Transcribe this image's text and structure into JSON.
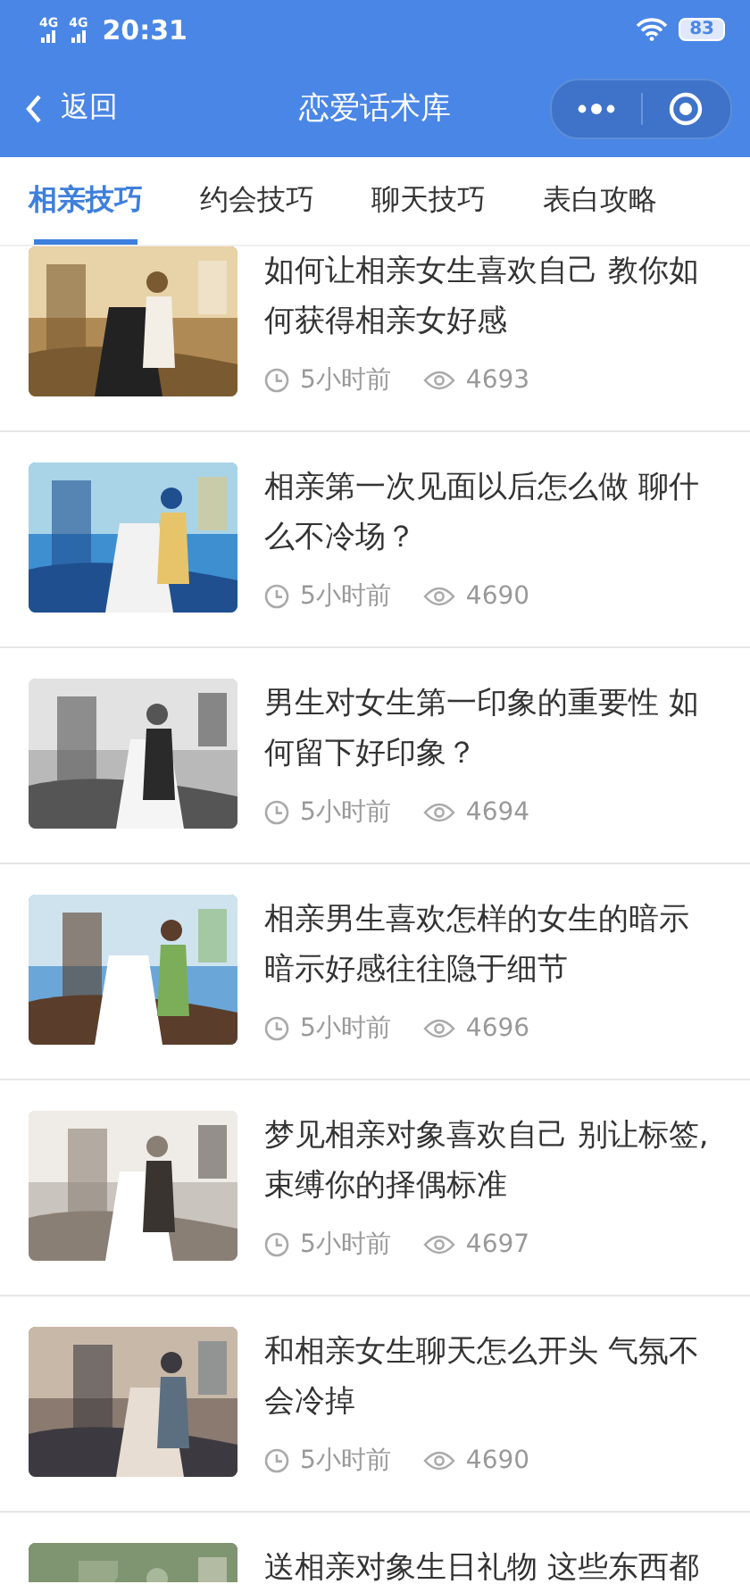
{
  "status_bar": {
    "network_1": "4G",
    "network_2": "4G",
    "time": "20:31",
    "battery": "83"
  },
  "nav_bar": {
    "back_label": "返回",
    "title": "恋爱话术库"
  },
  "tabs": [
    {
      "label": "相亲技巧",
      "selected": true
    },
    {
      "label": "约会技巧",
      "selected": false
    },
    {
      "label": "聊天技巧",
      "selected": false
    },
    {
      "label": "表白攻略",
      "selected": false
    }
  ],
  "articles": [
    {
      "title": "如何让相亲女生喜欢自己 教你如何获得相亲女好感",
      "time": "5小时前",
      "views": "4693"
    },
    {
      "title": "相亲第一次见面以后怎么做 聊什么不冷场？",
      "time": "5小时前",
      "views": "4690"
    },
    {
      "title": "男生对女生第一印象的重要性 如何留下好印象？",
      "time": "5小时前",
      "views": "4694"
    },
    {
      "title": "相亲男生喜欢怎样的女生的暗示暗示好感往往隐于细节",
      "time": "5小时前",
      "views": "4696"
    },
    {
      "title": "梦见相亲对象喜欢自己 别让标签,束缚你的择偶标准",
      "time": "5小时前",
      "views": "4697"
    },
    {
      "title": "和相亲女生聊天怎么开头 气氛不会冷掉",
      "time": "5小时前",
      "views": "4690"
    },
    {
      "title": "送相亲对象生日礼物 这些东西都"
    }
  ]
}
